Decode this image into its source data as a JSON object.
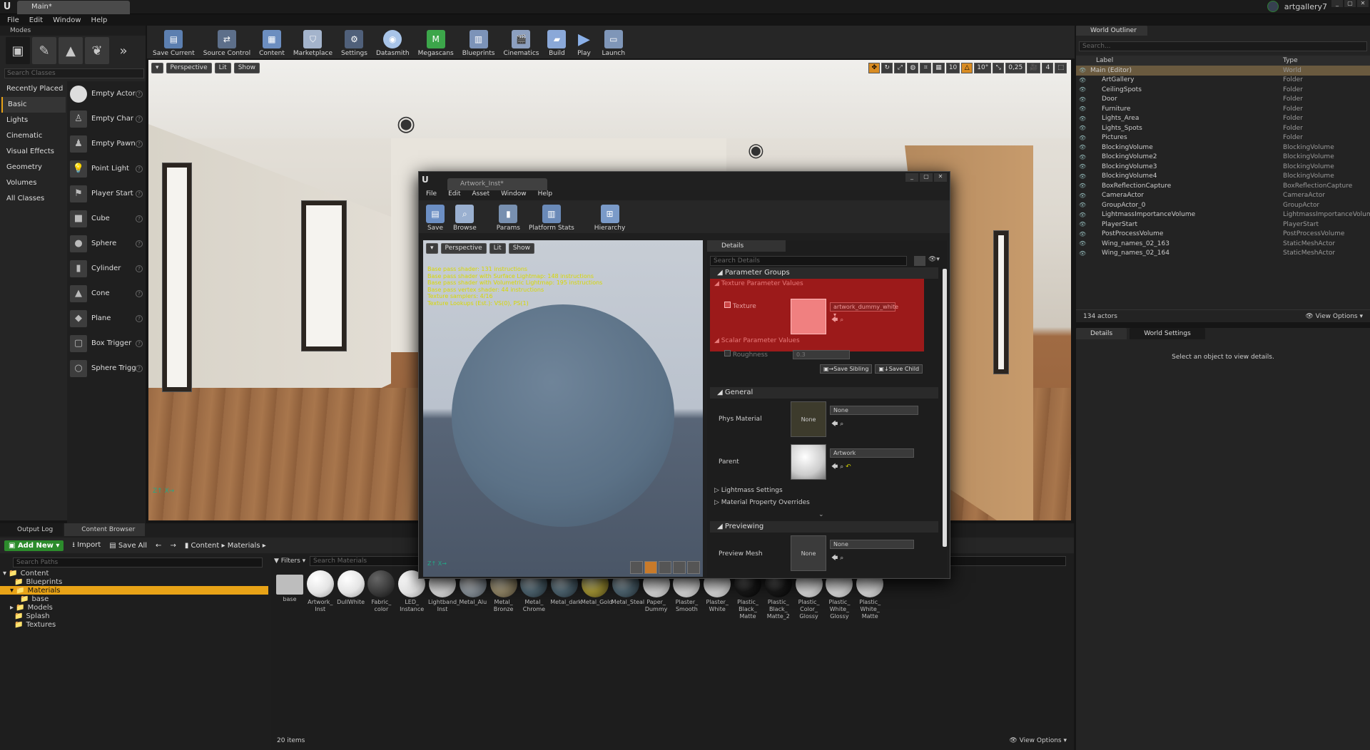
{
  "window": {
    "tab_title": "Main*",
    "project": "artgallery7"
  },
  "menu": [
    "File",
    "Edit",
    "Window",
    "Help"
  ],
  "modes": {
    "title": "Modes",
    "search_placeholder": "Search Classes",
    "categories": [
      "Recently Placed",
      "Basic",
      "Lights",
      "Cinematic",
      "Visual Effects",
      "Geometry",
      "Volumes",
      "All Classes"
    ],
    "selected_category": "Basic",
    "classes": [
      "Empty Actor",
      "Empty Char",
      "Empty Pawn",
      "Point Light",
      "Player Start",
      "Cube",
      "Sphere",
      "Cylinder",
      "Cone",
      "Plane",
      "Box Trigger",
      "Sphere Trigg"
    ]
  },
  "toolbar": [
    "Save Current",
    "Source Control",
    "Content",
    "Marketplace",
    "Settings",
    "Datasmith",
    "Megascans",
    "Blueprints",
    "Cinematics",
    "Build",
    "Play",
    "Launch"
  ],
  "viewport": {
    "perspective": "Perspective",
    "lit": "Lit",
    "show": "Show",
    "snap": "10",
    "angle": "10°",
    "scale": "0,25",
    "cam": "4"
  },
  "outliner": {
    "title": "World Outliner",
    "search_placeholder": "Search...",
    "col_label": "Label",
    "col_type": "Type",
    "rows": [
      {
        "name": "Main (Editor)",
        "type": "World",
        "indent": 0
      },
      {
        "name": "ArtGallery",
        "type": "Folder",
        "indent": 1
      },
      {
        "name": "CeilingSpots",
        "type": "Folder",
        "indent": 1
      },
      {
        "name": "Door",
        "type": "Folder",
        "indent": 1
      },
      {
        "name": "Furniture",
        "type": "Folder",
        "indent": 1
      },
      {
        "name": "Lights_Area",
        "type": "Folder",
        "indent": 1
      },
      {
        "name": "Lights_Spots",
        "type": "Folder",
        "indent": 1
      },
      {
        "name": "Pictures",
        "type": "Folder",
        "indent": 1
      },
      {
        "name": "BlockingVolume",
        "type": "BlockingVolume",
        "indent": 1
      },
      {
        "name": "BlockingVolume2",
        "type": "BlockingVolume",
        "indent": 1
      },
      {
        "name": "BlockingVolume3",
        "type": "BlockingVolume",
        "indent": 1
      },
      {
        "name": "BlockingVolume4",
        "type": "BlockingVolume",
        "indent": 1
      },
      {
        "name": "BoxReflectionCapture",
        "type": "BoxReflectionCapture",
        "indent": 1
      },
      {
        "name": "CameraActor",
        "type": "CameraActor",
        "indent": 1
      },
      {
        "name": "GroupActor_0",
        "type": "GroupActor",
        "indent": 1
      },
      {
        "name": "LightmassImportanceVolume",
        "type": "LightmassImportanceVolum",
        "indent": 1
      },
      {
        "name": "PlayerStart",
        "type": "PlayerStart",
        "indent": 1
      },
      {
        "name": "PostProcessVolume",
        "type": "PostProcessVolume",
        "indent": 1
      },
      {
        "name": "Wing_names_02_163",
        "type": "StaticMeshActor",
        "indent": 1
      },
      {
        "name": "Wing_names_02_164",
        "type": "StaticMeshActor",
        "indent": 1
      }
    ],
    "count": "134 actors",
    "view_options": "View Options"
  },
  "details_right": {
    "tab1": "Details",
    "tab2": "World Settings",
    "empty": "Select an object to view details."
  },
  "bottom": {
    "tab_output": "Output Log",
    "tab_cb": "Content Browser",
    "add_new": "Add New",
    "import": "Import",
    "save_all": "Save All",
    "path1": "Content",
    "path2": "Materials",
    "search_paths": "Search Paths",
    "filters": "Filters",
    "search_materials": "Search Materials",
    "tree": [
      "Content",
      "Blueprints",
      "Materials",
      "base",
      "Models",
      "Splash",
      "Textures"
    ],
    "items_count": "20 items",
    "view_options": "View Options",
    "assets": [
      {
        "name": "base",
        "kind": "folder"
      },
      {
        "name": "Artwork_ Inst",
        "kind": "white"
      },
      {
        "name": "DullWhite",
        "kind": "white"
      },
      {
        "name": "Fabric_ color",
        "kind": "dark"
      },
      {
        "name": "LED_ Instance",
        "kind": "white"
      },
      {
        "name": "Lightband_ Inst",
        "kind": "white"
      },
      {
        "name": "Metal_Alu",
        "kind": "metal"
      },
      {
        "name": "Metal_ Bronze",
        "kind": "bronze"
      },
      {
        "name": "Metal_ Chrome",
        "kind": "chrome"
      },
      {
        "name": "Metal_dark",
        "kind": "chrome"
      },
      {
        "name": "Metal_Gold",
        "kind": "gold"
      },
      {
        "name": "Metal_Steal",
        "kind": "chrome"
      },
      {
        "name": "Paper_ Dummy",
        "kind": "white"
      },
      {
        "name": "Plaster_ Smooth",
        "kind": "white"
      },
      {
        "name": "Plaster_ White",
        "kind": "white"
      },
      {
        "name": "Plastic_ Black_ Matte",
        "kind": "black"
      },
      {
        "name": "Plastic_ Black_ Matte_2",
        "kind": "black"
      },
      {
        "name": "Plastic_ Color_ Glossy",
        "kind": "white"
      },
      {
        "name": "Plastic_ White_ Glossy",
        "kind": "white"
      },
      {
        "name": "Plastic_ White_ Matte",
        "kind": "white"
      }
    ]
  },
  "material_editor": {
    "tab": "Artwork_Inst*",
    "menu": [
      "File",
      "Edit",
      "Asset",
      "Window",
      "Help"
    ],
    "toolbar": [
      "Save",
      "Browse",
      "Params",
      "Platform Stats",
      "Hierarchy"
    ],
    "vp_perspective": "Perspective",
    "vp_lit": "Lit",
    "vp_show": "Show",
    "stats": [
      "Base pass shader: 131 instructions",
      "Base pass shader with Surface Lightmap: 148 instructions",
      "Base pass shader with Volumetric Lightmap: 195 instructions",
      "Base pass vertex shader: 44 instructions",
      "Texture samplers: 4/16",
      "Texture Lookups (Est.): VS(0), PS(1)"
    ],
    "details_tab": "Details",
    "search_details": "Search Details",
    "param_groups": "Parameter Groups",
    "tex_param_values": "Texture Parameter Values",
    "texture_label": "Texture",
    "texture_value": "artwork_dummy_white",
    "scalar_param_values": "Scalar Parameter Values",
    "roughness_label": "Roughness",
    "roughness_value": "0.3",
    "save_sibling": "Save Sibling",
    "save_child": "Save Child",
    "general": "General",
    "phys_material": "Phys Material",
    "phys_thumb": "None",
    "phys_value": "None",
    "parent": "Parent",
    "parent_value": "Artwork",
    "lightmass": "Lightmass Settings",
    "mat_override": "Material Property Overrides",
    "previewing": "Previewing",
    "preview_mesh": "Preview Mesh",
    "preview_thumb": "None",
    "preview_value": "None"
  }
}
